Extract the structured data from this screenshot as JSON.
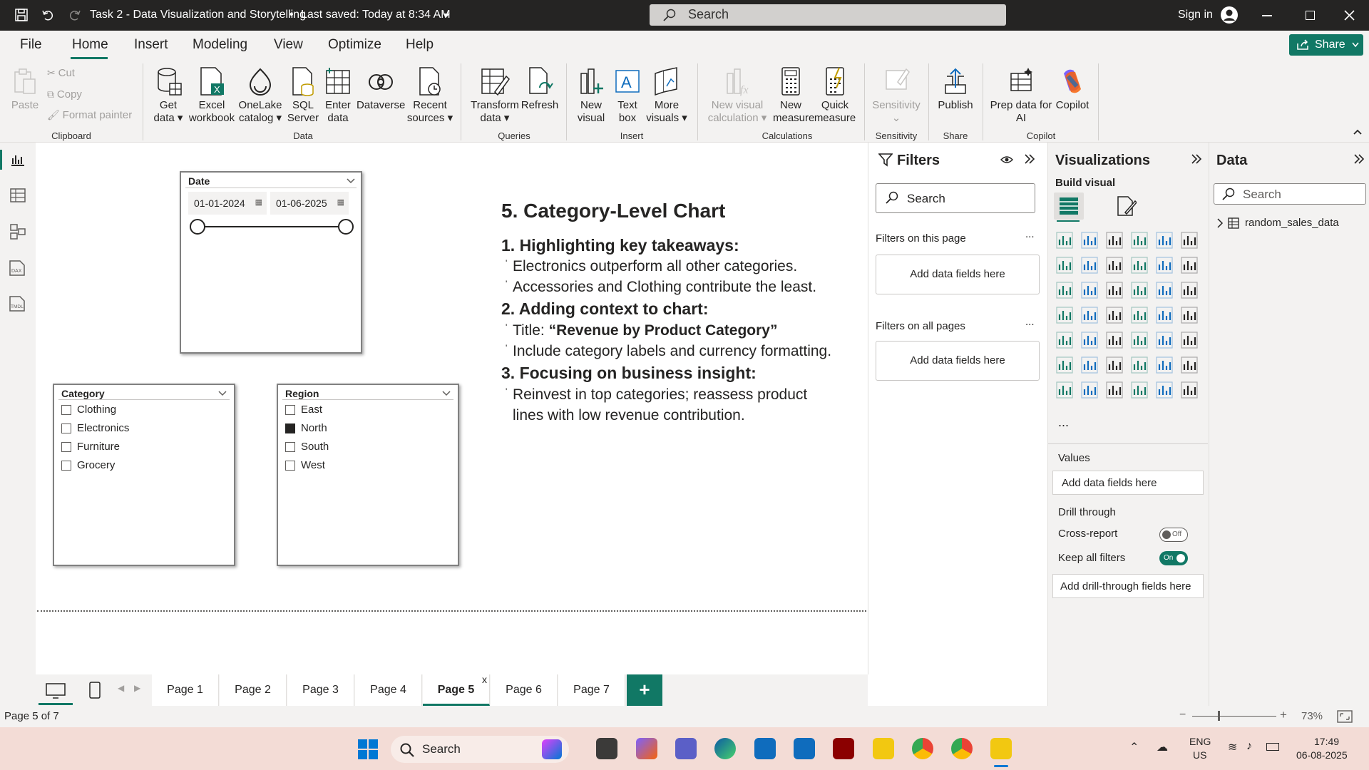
{
  "window": {
    "title": "Task 2 - Data Visualization and Storytelling",
    "saved": "Last saved: Today at 8:34 AM",
    "search_placeholder": "Search",
    "signin": "Sign in"
  },
  "menu": {
    "items": [
      "File",
      "Home",
      "Insert",
      "Modeling",
      "View",
      "Optimize",
      "Help"
    ],
    "active": "Home",
    "share": "Share"
  },
  "ribbon": {
    "clipboard": {
      "paste": "Paste",
      "cut": "Cut",
      "copy": "Copy",
      "format_painter": "Format painter",
      "group": "Clipboard"
    },
    "data": {
      "get_data": "Get",
      "get_data2": "data",
      "excel": "Excel",
      "excel2": "workbook",
      "onelake": "OneLake",
      "onelake2": "catalog",
      "sql": "SQL",
      "sql2": "Server",
      "enter": "Enter",
      "enter2": "data",
      "dataverse": "Dataverse",
      "recent": "Recent",
      "recent2": "sources",
      "group": "Data"
    },
    "queries": {
      "transform": "Transform",
      "transform2": "data",
      "refresh": "Refresh",
      "group": "Queries"
    },
    "insert": {
      "new_visual": "New",
      "new_visual2": "visual",
      "text_box": "Text",
      "text_box2": "box",
      "more": "More",
      "more2": "visuals",
      "group": "Insert"
    },
    "calculations": {
      "new_visual_calc": "New visual",
      "new_visual_calc2": "calculation",
      "new_measure": "New",
      "new_measure2": "measure",
      "quick": "Quick",
      "quick2": "measure",
      "group": "Calculations"
    },
    "sensitivity": {
      "label": "Sensitivity",
      "group": "Sensitivity"
    },
    "share": {
      "publish": "Publish",
      "group": "Share"
    },
    "copilot": {
      "prep": "Prep data for",
      "prep2": "AI",
      "copilot": "Copilot",
      "group": "Copilot"
    }
  },
  "slicers": {
    "date": {
      "title": "Date",
      "from": "01-01-2024",
      "to": "01-06-2025"
    },
    "category": {
      "title": "Category",
      "items": [
        "Clothing",
        "Electronics",
        "Furniture",
        "Grocery"
      ]
    },
    "region": {
      "title": "Region",
      "items": [
        "East",
        "North",
        "South",
        "West"
      ],
      "checked": "North"
    }
  },
  "story": {
    "heading": "5. Category-Level Chart",
    "s1": "1. Highlighting key takeaways:",
    "s1b1": "Electronics outperform all other categories.",
    "s1b2": "Accessories and Clothing contribute the least.",
    "s2": "2. Adding context to chart:",
    "s2b1a": "Title: ",
    "s2b1b": "“Revenue by Product Category”",
    "s2b2": "Include category labels and currency formatting.",
    "s3": "3. Focusing on business insight:",
    "s3b1": "Reinvest in top categories; reassess product lines with low revenue contribution."
  },
  "filters": {
    "title": "Filters",
    "search": "Search",
    "this_page": "Filters on this page",
    "all_pages": "Filters on all pages",
    "add": "Add data fields here",
    "more": "..."
  },
  "viz": {
    "title": "Visualizations",
    "build": "Build visual",
    "values": "Values",
    "add": "Add data fields here",
    "drill": "Drill through",
    "cross": "Cross-report",
    "cross_state": "Off",
    "keep": "Keep all filters",
    "keep_state": "On",
    "add_drill": "Add drill-through fields here",
    "more": "..."
  },
  "data": {
    "title": "Data",
    "search": "Search",
    "table": "random_sales_data"
  },
  "pages": {
    "tabs": [
      "Page 1",
      "Page 2",
      "Page 3",
      "Page 4",
      "Page 5",
      "Page 6",
      "Page 7"
    ],
    "active": "Page 5",
    "close": "x",
    "add": "+"
  },
  "status": {
    "page": "Page 5 of 7",
    "zoom": "73%"
  },
  "taskbar": {
    "search": "Search",
    "lang1": "ENG",
    "lang2": "US",
    "time": "17:49",
    "date": "06-08-2025"
  },
  "colors": {
    "accent": "#117865",
    "titlebar": "#252423",
    "pbi_yellow": "#f2c811"
  }
}
